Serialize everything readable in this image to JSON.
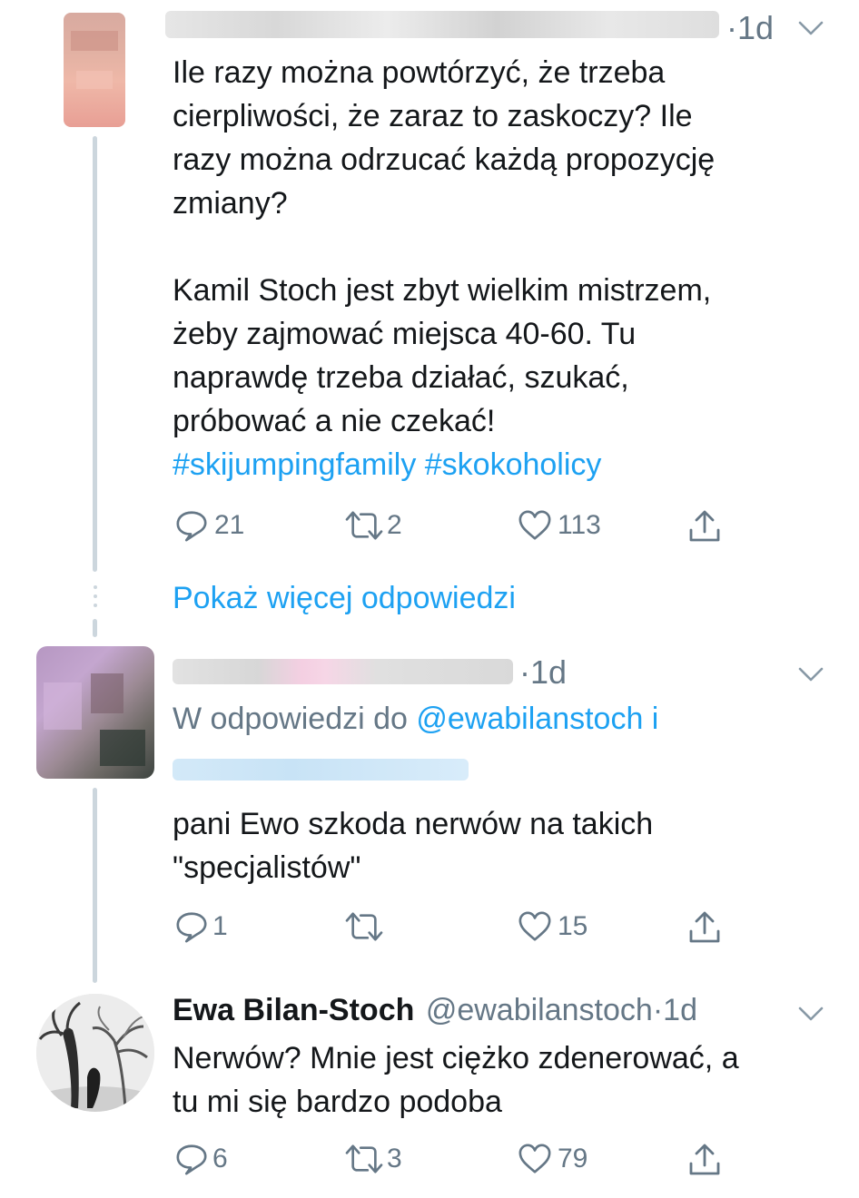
{
  "tweets": [
    {
      "time": "1d",
      "lines": [
        "Ile razy można powtórzyć, że trzeba",
        "cierpliwości, że zaraz to zaskoczy? Ile",
        "razy można odrzucać każdą propozycję",
        "zmiany?",
        "",
        "Kamil Stoch jest zbyt wielkim mistrzem,",
        "żeby zajmować miejsca 40-60. Tu",
        "naprawdę trzeba działać, szukać,",
        "próbować a nie czekać!"
      ],
      "hashtags": "#skijumpingfamily #skokoholicy",
      "actions": {
        "replies": "21",
        "retweets": "2",
        "likes": "113"
      }
    },
    {
      "time": "1d",
      "reply_to_prefix": "W odpowiedzi do",
      "reply_to_handle": "@ewabilanstoch i",
      "lines": [
        "pani Ewo szkoda nerwów na takich",
        "\"specjalistów\""
      ],
      "actions": {
        "replies": "1",
        "retweets": "",
        "likes": "15"
      }
    },
    {
      "name": "Ewa Bilan-Stoch",
      "handle": "@ewabilanstoch",
      "time": "1d",
      "lines": [
        "Nerwów? Mnie jest ciężko zdenerować, a",
        "tu mi się bardzo podoba"
      ],
      "actions": {
        "replies": "6",
        "retweets": "3",
        "likes": "79"
      }
    }
  ],
  "show_more": "Pokaż więcej odpowiedzi",
  "separator": "·",
  "icons": [
    "reply-icon",
    "retweet-icon",
    "like-icon",
    "share-icon",
    "chevron-down-icon"
  ],
  "colors": {
    "accent": "#1da1f2",
    "muted": "#657786",
    "text": "#14171a",
    "thread": "#ccd6dd"
  }
}
